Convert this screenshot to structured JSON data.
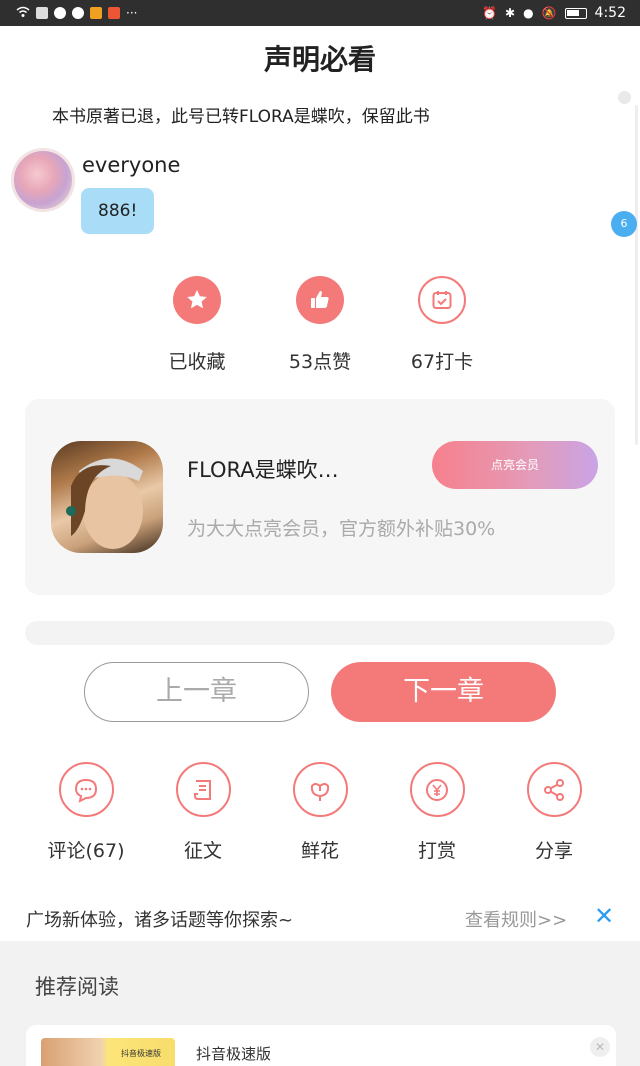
{
  "status_bar": {
    "time": "4:52",
    "overflow": "···"
  },
  "page": {
    "title": "声明必看",
    "notice": "本书原著已退，此号已转FLORA是蝶吹，保留此书",
    "page_badge": "6"
  },
  "comment": {
    "username": "everyone",
    "text": "886!"
  },
  "actions": [
    {
      "label": "已收藏",
      "icon": "star-icon"
    },
    {
      "label": "53点赞",
      "icon": "thumbs-up-icon"
    },
    {
      "label": "67打卡",
      "icon": "calendar-check-icon"
    }
  ],
  "member_card": {
    "name": "FLORA是蝶吹…",
    "subtitle": "为大大点亮会员，官方额外补贴30%",
    "button": "点亮会员"
  },
  "chapter_nav": {
    "prev": "上一章",
    "next": "下一章"
  },
  "tools": [
    {
      "label": "评论(67)",
      "icon": "comment-icon"
    },
    {
      "label": "征文",
      "icon": "scroll-icon"
    },
    {
      "label": "鲜花",
      "icon": "flower-icon"
    },
    {
      "label": "打赏",
      "icon": "yen-icon"
    },
    {
      "label": "分享",
      "icon": "share-icon"
    }
  ],
  "plaza": {
    "text": "广场新体验，诸多话题等你探索~",
    "rules": "查看规则>>",
    "close": "✕"
  },
  "recommend": {
    "title": "推荐阅读",
    "item_name": "抖音极速版",
    "thumb_text": "抖音极速版"
  },
  "colors": {
    "accent": "#f47a7a",
    "bubble": "#a9ddf7",
    "link_blue": "#2b9cf0"
  }
}
